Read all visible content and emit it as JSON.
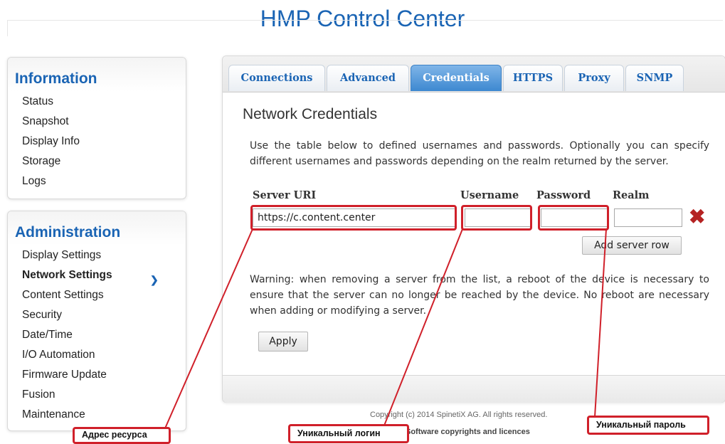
{
  "header": {
    "title": "HMP Control Center"
  },
  "sidebar": {
    "information": {
      "heading": "Information",
      "items": [
        {
          "label": "Status"
        },
        {
          "label": "Snapshot"
        },
        {
          "label": "Display Info"
        },
        {
          "label": "Storage"
        },
        {
          "label": "Logs"
        }
      ]
    },
    "administration": {
      "heading": "Administration",
      "items": [
        {
          "label": "Display Settings"
        },
        {
          "label": "Network Settings",
          "active": true
        },
        {
          "label": "Content Settings"
        },
        {
          "label": "Security"
        },
        {
          "label": "Date/Time"
        },
        {
          "label": "I/O Automation"
        },
        {
          "label": "Firmware Update"
        },
        {
          "label": "Fusion"
        },
        {
          "label": "Maintenance"
        }
      ]
    }
  },
  "tabs": [
    {
      "label": "Connections"
    },
    {
      "label": "Advanced"
    },
    {
      "label": "Credentials",
      "active": true
    },
    {
      "label": "HTTPS"
    },
    {
      "label": "Proxy"
    },
    {
      "label": "SNMP"
    }
  ],
  "main": {
    "title": "Network Credentials",
    "description": "Use the table below to defined usernames and passwords. Optionally you can specify different usernames and passwords depending on the realm returned by the server.",
    "columns": {
      "server_uri": "Server URI",
      "username": "Username",
      "password": "Password",
      "realm": "Realm"
    },
    "row": {
      "server_uri": "https://c.content.center",
      "username": "",
      "password": "",
      "realm": ""
    },
    "delete_icon": "close-x-icon",
    "add_row_label": "Add server row",
    "warning": "Warning: when removing a server from the list, a reboot of the device is necessary to ensure that the server can no longer be reached by the device. No reboot are necessary when adding or modifying a server.",
    "apply_label": "Apply"
  },
  "footer": {
    "copyright": "Copyright (c) 2014 SpinetiX AG. All rights reserved.",
    "licences": "Software copyrights and licences"
  },
  "annotations": {
    "resource_address": "Адрес ресурса",
    "unique_login": "Уникальный логин",
    "unique_password": "Уникальный пароль"
  },
  "colors": {
    "brand_blue": "#1a64b4",
    "tab_active": "#3d88d0",
    "annotation_red": "#d0202a",
    "delete_red": "#b52222"
  }
}
